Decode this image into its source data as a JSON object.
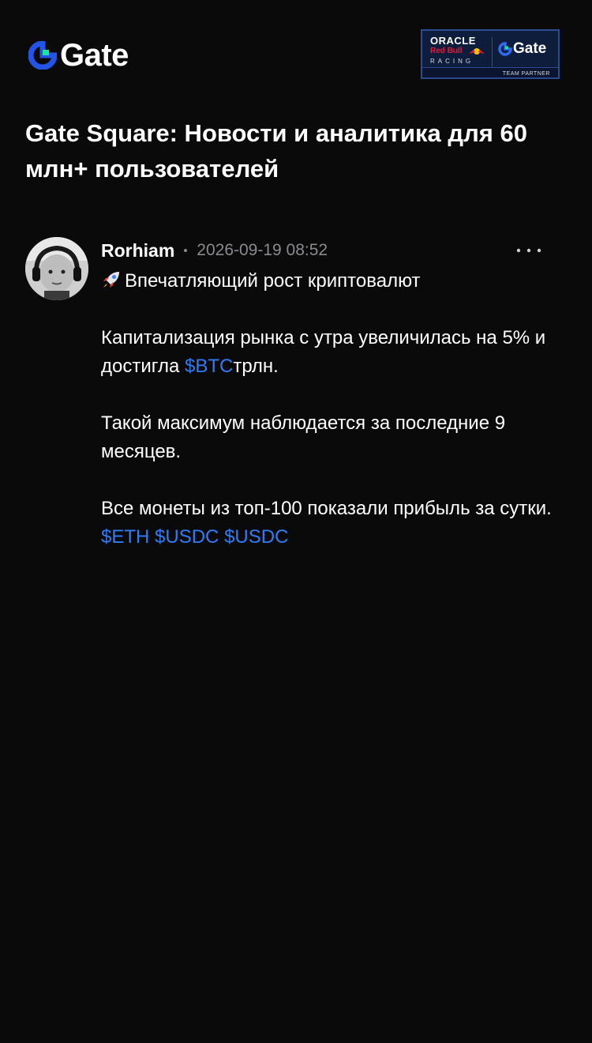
{
  "header": {
    "logo_text": "Gate",
    "partner": {
      "oracle": "ORACLE",
      "redbull": "Red Bull",
      "racing": "RACING",
      "gate": "Gate",
      "team_partner": "TEAM PARTNER"
    }
  },
  "page_title": "Gate Square: Новости и аналитика для 60 млн+ пользователей",
  "post": {
    "author": "Rorhiam",
    "timestamp": "2026-09-19 08:52",
    "headline": "Впечатляющий рост криптовалют",
    "paragraph1_part1": "Капитализация рынка с утра увеличилась на 5% и достигла ",
    "paragraph1_ticker": "$BTC",
    "paragraph1_part2": "трлн.",
    "paragraph2": "Такой максимум наблюдается за последние 9 месяцев.",
    "paragraph3": "Все монеты из топ-100 показали прибыль за сутки.",
    "tickers": [
      "$ETH",
      "$USDC",
      "$USDC"
    ]
  },
  "colors": {
    "background": "#0a0a0b",
    "text": "#ffffff",
    "muted": "#8a8a8f",
    "link": "#2f7cf6",
    "brand_blue": "#2354e6",
    "brand_green": "#17e6a1"
  },
  "icons": {
    "logo": "gate-logo-icon",
    "more": "more-dots-icon",
    "rocket": "rocket-emoji-icon"
  }
}
